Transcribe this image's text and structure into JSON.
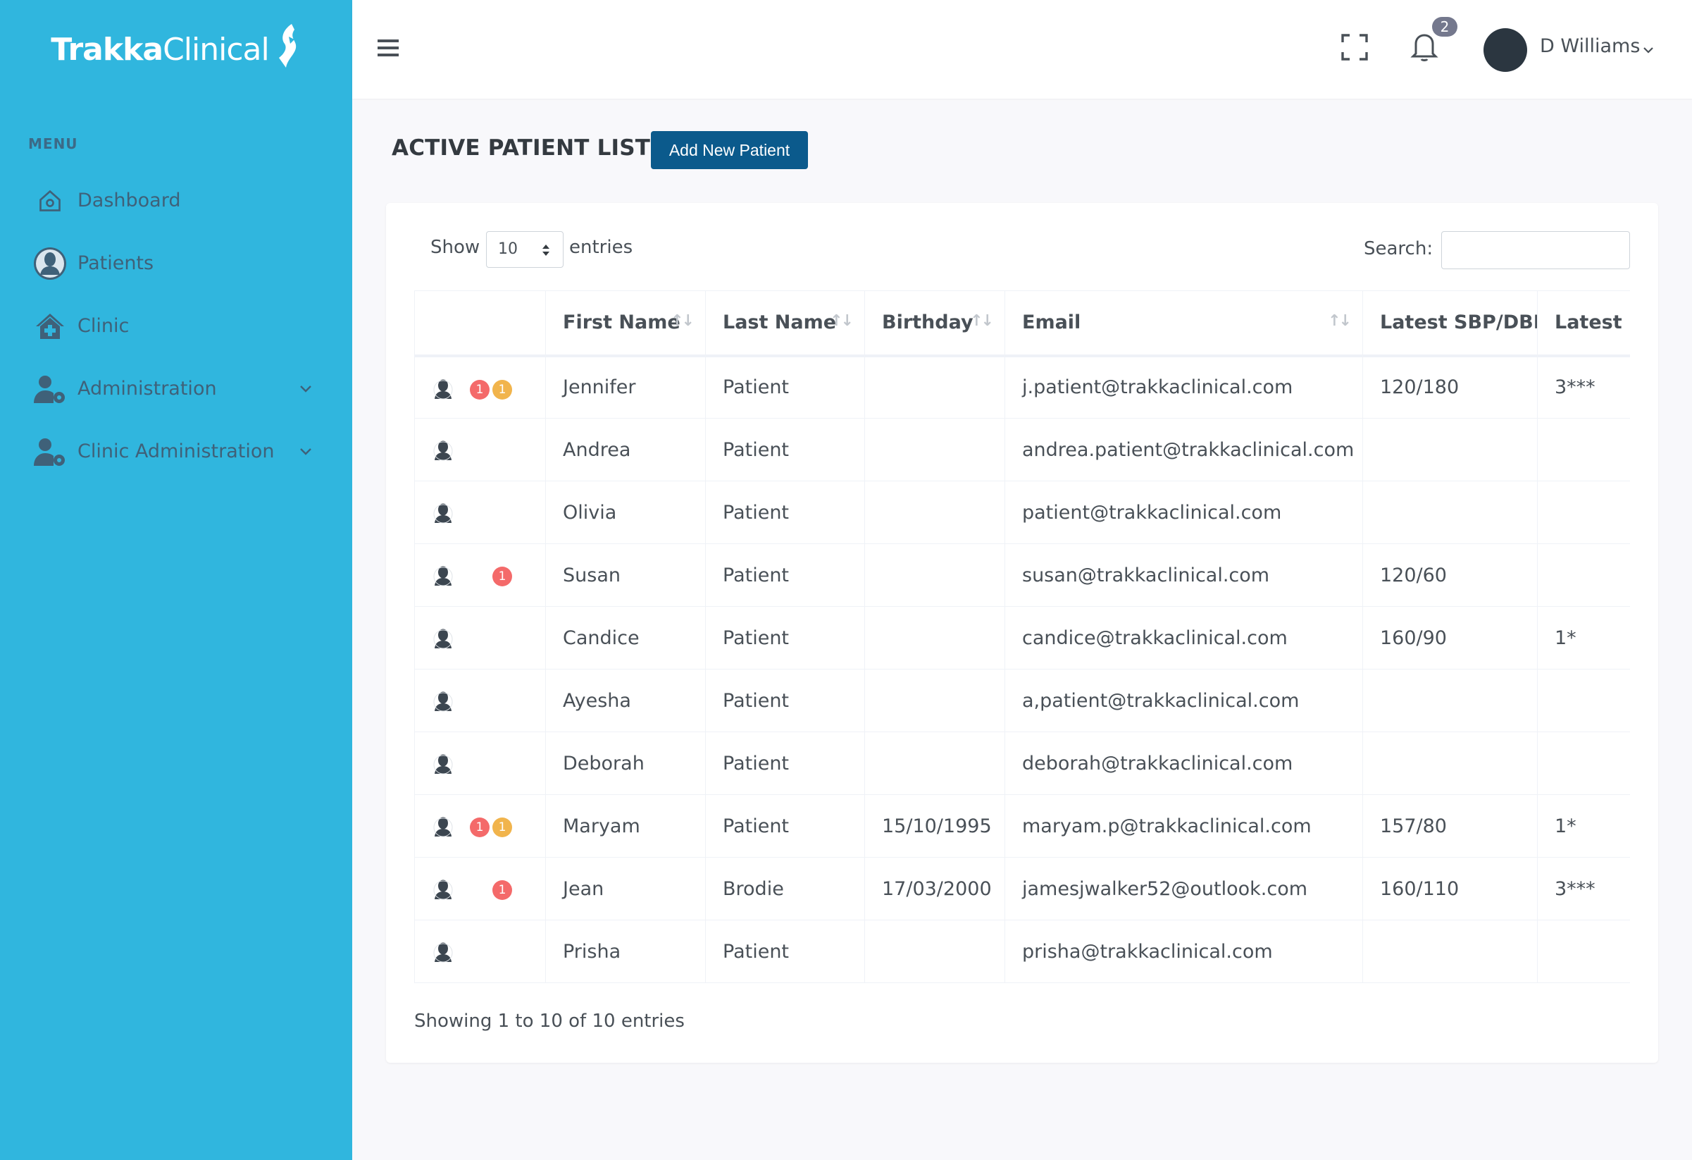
{
  "brand": {
    "name_bold": "Trakka",
    "name_light": "Clinical"
  },
  "sidebar": {
    "menu_title": "MENU",
    "items": [
      {
        "label": "Dashboard",
        "icon": "home-icon"
      },
      {
        "label": "Patients",
        "icon": "user-circle-icon"
      },
      {
        "label": "Clinic",
        "icon": "clinic-house-icon"
      },
      {
        "label": "Administration",
        "icon": "user-gear-icon",
        "expandable": true
      },
      {
        "label": "Clinic Administration",
        "icon": "user-gear-icon",
        "expandable": true
      }
    ]
  },
  "topbar": {
    "notification_count": "2",
    "user_name": "D Williams"
  },
  "page": {
    "title": "ACTIVE PATIENT LIST",
    "add_button": "Add New Patient"
  },
  "table_controls": {
    "show_label": "Show",
    "entries_value": "10",
    "entries_label": "entries",
    "search_label": "Search:",
    "search_value": ""
  },
  "table": {
    "columns": [
      "",
      "First Name",
      "Last Name",
      "Birthday",
      "Email",
      "Latest SBP/DBP",
      "Latest U"
    ],
    "rows": [
      {
        "badges": [
          "red",
          "amber"
        ],
        "first": "Jennifer",
        "last": "Patient",
        "birthday": "",
        "email": "j.patient@trakkaclinical.com",
        "sbp": "120/180",
        "latest_u": "3***"
      },
      {
        "badges": [],
        "first": "Andrea",
        "last": "Patient",
        "birthday": "",
        "email": "andrea.patient@trakkaclinical.com",
        "sbp": "",
        "latest_u": ""
      },
      {
        "badges": [],
        "first": "Olivia",
        "last": "Patient",
        "birthday": "",
        "email": "patient@trakkaclinical.com",
        "sbp": "",
        "latest_u": ""
      },
      {
        "badges": [
          "red"
        ],
        "first": "Susan",
        "last": "Patient",
        "birthday": "",
        "email": "susan@trakkaclinical.com",
        "sbp": "120/60",
        "latest_u": ""
      },
      {
        "badges": [],
        "first": "Candice",
        "last": "Patient",
        "birthday": "",
        "email": "candice@trakkaclinical.com",
        "sbp": "160/90",
        "latest_u": "1*"
      },
      {
        "badges": [],
        "first": "Ayesha",
        "last": "Patient",
        "birthday": "",
        "email": "a,patient@trakkaclinical.com",
        "sbp": "",
        "latest_u": ""
      },
      {
        "badges": [],
        "first": "Deborah",
        "last": "Patient",
        "birthday": "",
        "email": "deborah@trakkaclinical.com",
        "sbp": "",
        "latest_u": ""
      },
      {
        "badges": [
          "red",
          "amber"
        ],
        "first": "Maryam",
        "last": "Patient",
        "birthday": "15/10/1995",
        "email": "maryam.p@trakkaclinical.com",
        "sbp": "157/80",
        "latest_u": "1*"
      },
      {
        "badges": [
          "red"
        ],
        "first": "Jean",
        "last": "Brodie",
        "birthday": "17/03/2000",
        "email": "jamesjwalker52@outlook.com",
        "sbp": "160/110",
        "latest_u": "3***"
      },
      {
        "badges": [],
        "first": "Prisha",
        "last": "Patient",
        "birthday": "",
        "email": "prisha@trakkaclinical.com",
        "sbp": "",
        "latest_u": ""
      }
    ],
    "badge_text": "1"
  },
  "footer": {
    "info": "Showing 1 to 10 of 10 entries"
  },
  "colors": {
    "sidebar": "#30b6de",
    "primary_button": "#0b5a8c",
    "badge_red": "#f46a6a",
    "badge_amber": "#f1b44c"
  }
}
